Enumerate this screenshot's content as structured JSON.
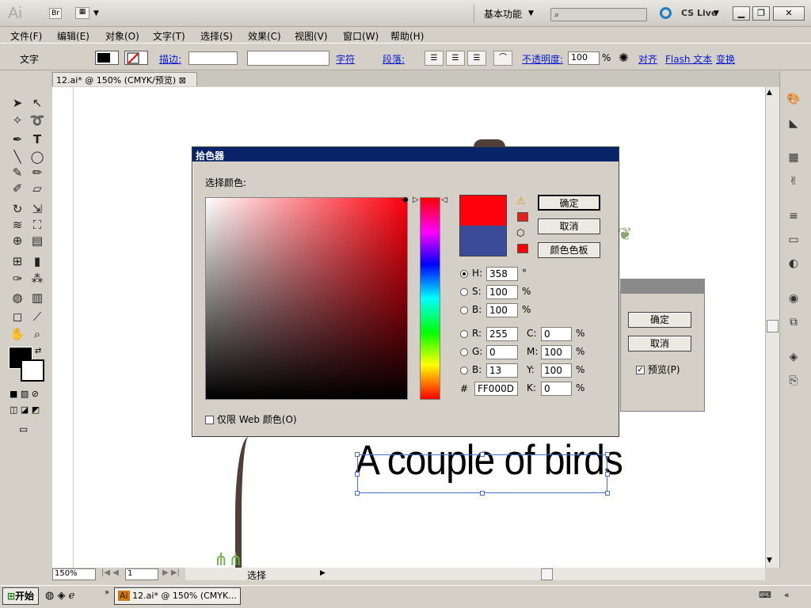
{
  "app": {
    "logo": "Ai",
    "bridge": "Br",
    "workspace": "基本功能",
    "cslive": "CS Live"
  },
  "window": {
    "min": "▁",
    "max": "❐",
    "close": "✕"
  },
  "menu": [
    "文件(F)",
    "编辑(E)",
    "对象(O)",
    "文字(T)",
    "选择(S)",
    "效果(C)",
    "视图(V)",
    "窗口(W)",
    "帮助(H)"
  ],
  "control": {
    "tool": "文字",
    "stroke_label": "描边:",
    "char_label": "字符",
    "para_label": "段落:",
    "opacity_label": "不透明度:",
    "opacity_value": "100",
    "opacity_unit": "%",
    "align_label": "对齐",
    "flash_label": "Flash 文本",
    "transform_label": "变换"
  },
  "document": {
    "tab": "12.ai* @ 150% (CMYK/预览)"
  },
  "status": {
    "zoom": "150%",
    "page": "1",
    "mode": "选择"
  },
  "artwork": {
    "text": "A couple of birds"
  },
  "dialog2": {
    "ok": "确定",
    "cancel": "取消",
    "preview": "预览(P)"
  },
  "picker": {
    "title": "拾色器",
    "select_label": "选择颜色:",
    "ok": "确定",
    "cancel": "取消",
    "swatches": "颜色色板",
    "H": "358",
    "H_unit": "°",
    "S": "100",
    "S_unit": "%",
    "B": "100",
    "B_unit": "%",
    "R": "255",
    "G": "0",
    "Bl": "13",
    "C": "0",
    "M": "100",
    "Y": "100",
    "K": "0",
    "hex": "FF000D",
    "web_only": "仅限 Web 颜色(O)",
    "labels": {
      "H": "H:",
      "S": "S:",
      "B": "B:",
      "R": "R:",
      "G": "G:",
      "Bl": "B:",
      "C": "C:",
      "M": "M:",
      "Y": "Y:",
      "K": "K:",
      "hash": "#"
    },
    "pct": "%",
    "new_color": "#ff000d",
    "old_color": "#3c4a9a"
  },
  "taskbar": {
    "start": "开始",
    "task": "12.ai* @ 150% (CMYK..."
  }
}
